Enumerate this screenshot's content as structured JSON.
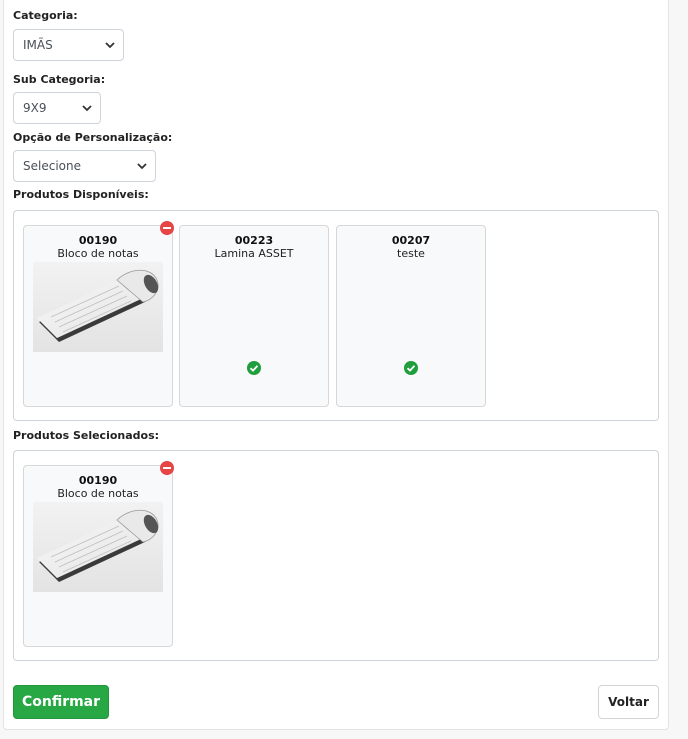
{
  "form": {
    "category": {
      "label": "Categoria:",
      "value": "IMÃS"
    },
    "subcategory": {
      "label": "Sub Categoria:",
      "value": "9X9"
    },
    "personalization": {
      "label": "Opção de Personalização:",
      "value": "Selecione"
    }
  },
  "available": {
    "label": "Produtos Disponíveis:",
    "products": [
      {
        "code": "00190",
        "name": "Bloco de notas",
        "has_image": true,
        "state": "selected"
      },
      {
        "code": "00223",
        "name": "Lamina ASSET",
        "has_image": false,
        "state": "available"
      },
      {
        "code": "00207",
        "name": "teste",
        "has_image": false,
        "state": "available"
      }
    ]
  },
  "selected": {
    "label": "Produtos Selecionados:",
    "products": [
      {
        "code": "00190",
        "name": "Bloco de notas",
        "has_image": true
      }
    ]
  },
  "actions": {
    "confirm_label": "Confirmar",
    "back_label": "Voltar"
  },
  "icons": {
    "remove": "remove-circle-icon",
    "check": "check-circle-icon",
    "chevron": "chevron-down-icon"
  },
  "colors": {
    "accent_green": "#28a745",
    "check_green": "#1e9e3c",
    "remove_red": "#e64545"
  }
}
